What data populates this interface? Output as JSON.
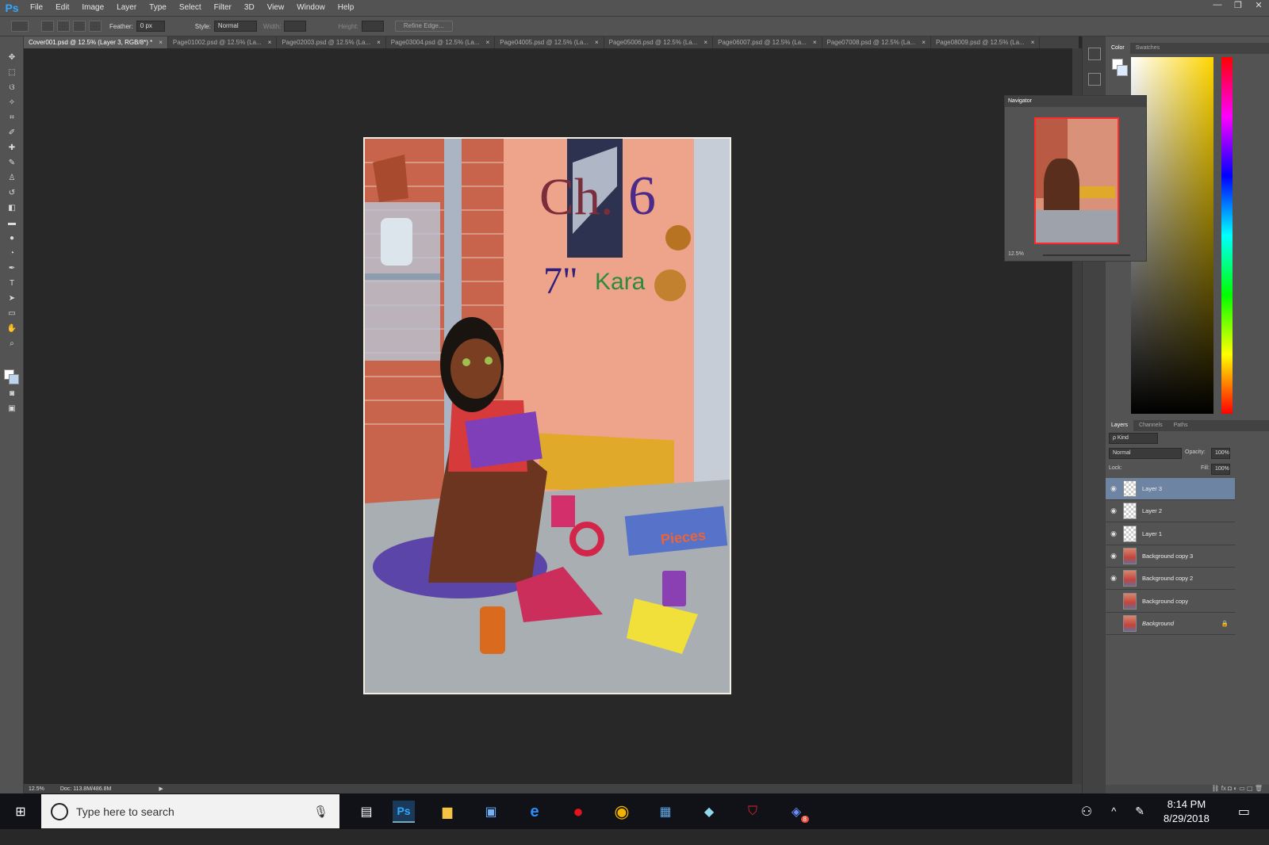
{
  "app": {
    "logo": "Ps",
    "menus": [
      "File",
      "Edit",
      "Image",
      "Layer",
      "Type",
      "Select",
      "Filter",
      "3D",
      "View",
      "Window",
      "Help"
    ],
    "window_controls": [
      "—",
      "❐",
      "✕"
    ]
  },
  "options": {
    "feather_label": "Feather:",
    "feather_value": "0 px",
    "style_label": "Style:",
    "style_value": "Normal",
    "width_label": "Width:",
    "height_label": "Height:",
    "refine_edge": "Refine Edge..."
  },
  "tabs": [
    {
      "label": "Cover001.psd @ 12.5% (Layer 3, RGB/8*) *",
      "active": true
    },
    {
      "label": "Page01002.psd @ 12.5% (La..."
    },
    {
      "label": "Page02003.psd @ 12.5% (La..."
    },
    {
      "label": "Page03004.psd @ 12.5% (La..."
    },
    {
      "label": "Page04005.psd @ 12.5% (La..."
    },
    {
      "label": "Page05006.psd @ 12.5% (La..."
    },
    {
      "label": "Page06007.psd @ 12.5% (La..."
    },
    {
      "label": "Page07008.psd @ 12.5% (La..."
    },
    {
      "label": "Page08009.psd @ 12.5% (La..."
    }
  ],
  "artwork": {
    "title_ch": "Ch.",
    "title_num": "6",
    "subtitle_num": "7\"",
    "subtitle_name": "Kara",
    "box_label": "Pieces"
  },
  "status": {
    "zoom": "12.5%",
    "doc": "Doc: 113.8M/486.8M"
  },
  "color_panel": {
    "tabs": [
      "Color",
      "Swatches"
    ]
  },
  "navigator": {
    "title": "Navigator",
    "zoom": "12.5%"
  },
  "layers_panel": {
    "tabs": [
      "Layers",
      "Channels",
      "Paths"
    ],
    "kind": "ρ Kind",
    "blend": "Normal",
    "opacity_label": "Opacity:",
    "opacity": "100%",
    "lock_label": "Lock:",
    "fill_label": "Fill:",
    "fill": "100%",
    "layers": [
      {
        "name": "Layer 3",
        "visible": true,
        "selected": true,
        "art": false
      },
      {
        "name": "Layer 2",
        "visible": true,
        "art": false
      },
      {
        "name": "Layer 1",
        "visible": true,
        "art": false
      },
      {
        "name": "Background copy 3",
        "visible": true,
        "art": true
      },
      {
        "name": "Background copy 2",
        "visible": true,
        "art": true
      },
      {
        "name": "Background copy",
        "visible": false,
        "art": true
      },
      {
        "name": "Background",
        "visible": false,
        "art": true,
        "locked": true
      }
    ]
  },
  "taskbar": {
    "search_placeholder": "Type here to search",
    "time": "8:14 PM",
    "date": "8/29/2018",
    "chat_badge": "8"
  },
  "colors": {
    "ui": "#535353",
    "canvas": "#282828",
    "selected_layer": "#6d84a3",
    "ps_blue": "#31a8ff"
  }
}
